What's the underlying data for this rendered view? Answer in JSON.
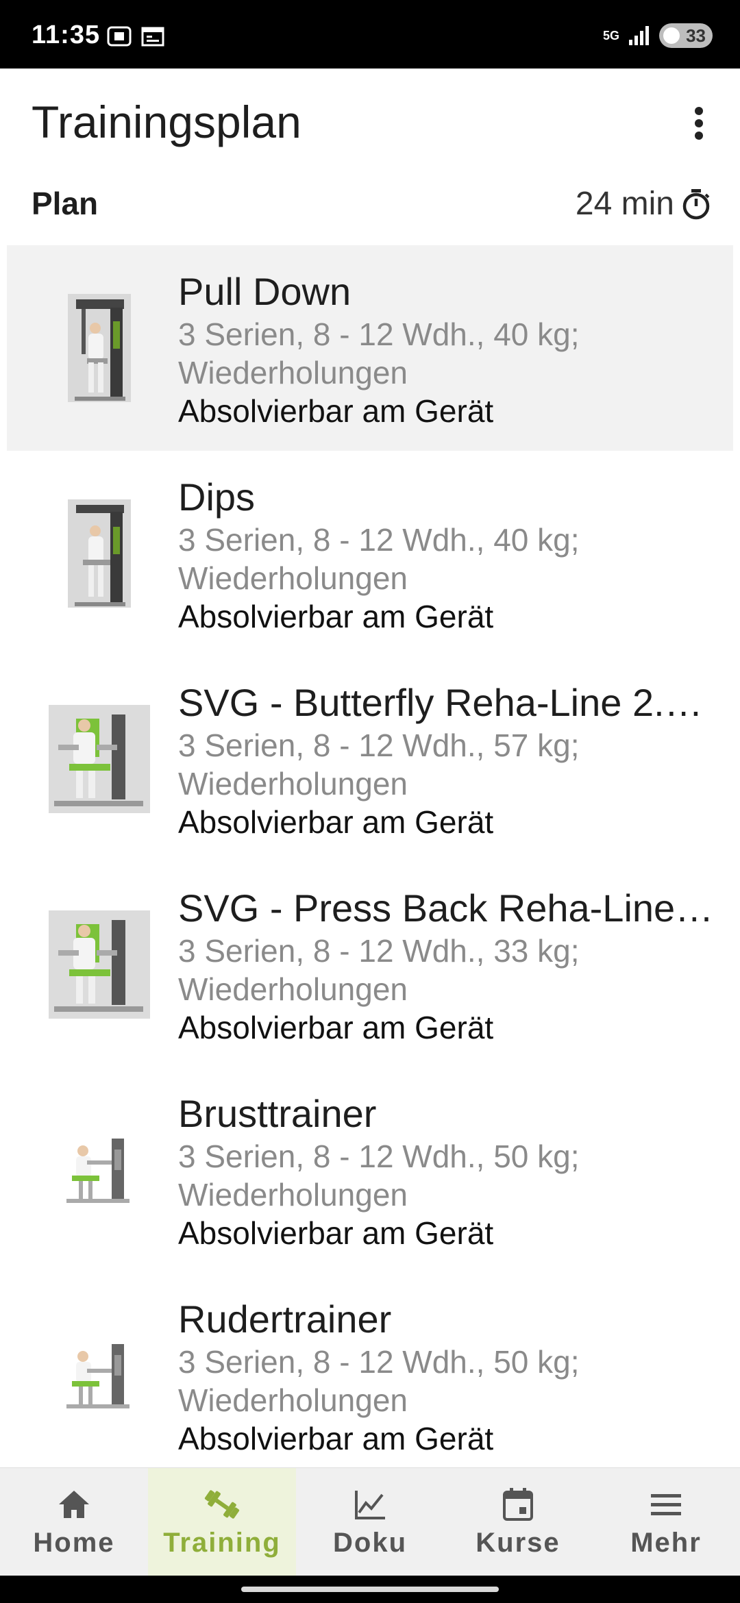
{
  "status_bar": {
    "time": "11:35",
    "network": "5G",
    "battery": "33",
    "left_icons": [
      "screenshot-icon",
      "calendar-icon"
    ],
    "right_icons": [
      "signal-icon",
      "battery-icon"
    ]
  },
  "app_bar": {
    "title": "Trainingsplan",
    "menu_icon": "more-vert-icon"
  },
  "section": {
    "label": "Plan",
    "duration": "24 min",
    "duration_icon": "timer-icon"
  },
  "exercises": [
    {
      "title": "Pull Down",
      "detail": "3 Serien, 8 - 12 Wdh., 40 kg;",
      "detail2": "Wiederholungen",
      "note": "Absolvierbar am Gerät",
      "selected": true
    },
    {
      "title": "Dips",
      "detail": "3 Serien, 8 - 12 Wdh., 40 kg;",
      "detail2": "Wiederholungen",
      "note": "Absolvierbar am Gerät"
    },
    {
      "title": "SVG - Butterfly Reha-Line 2.…",
      "detail": "3 Serien, 8 - 12 Wdh., 57 kg;",
      "detail2": "Wiederholungen",
      "note": "Absolvierbar am Gerät"
    },
    {
      "title": "SVG - Press Back Reha-Line …",
      "detail": "3 Serien, 8 - 12 Wdh., 33 kg;",
      "detail2": "Wiederholungen",
      "note": "Absolvierbar am Gerät"
    },
    {
      "title": "Brusttrainer",
      "detail": "3 Serien, 8 - 12 Wdh., 50 kg;",
      "detail2": "Wiederholungen",
      "note": "Absolvierbar am Gerät"
    },
    {
      "title": "Rudertrainer",
      "detail": "3 Serien, 8 - 12 Wdh., 50 kg;",
      "detail2": "Wiederholungen",
      "note": "Absolvierbar am Gerät"
    }
  ],
  "bottom_nav": [
    {
      "label": "Home",
      "icon": "home-icon"
    },
    {
      "label": "Training",
      "icon": "dumbbell-icon",
      "active": true
    },
    {
      "label": "Doku",
      "icon": "chart-icon"
    },
    {
      "label": "Kurse",
      "icon": "calendar-icon"
    },
    {
      "label": "Mehr",
      "icon": "menu-icon"
    }
  ],
  "colors": {
    "accent": "#8fae3a",
    "active_bg": "#eef3dc",
    "selected_row": "#f2f2f2"
  }
}
